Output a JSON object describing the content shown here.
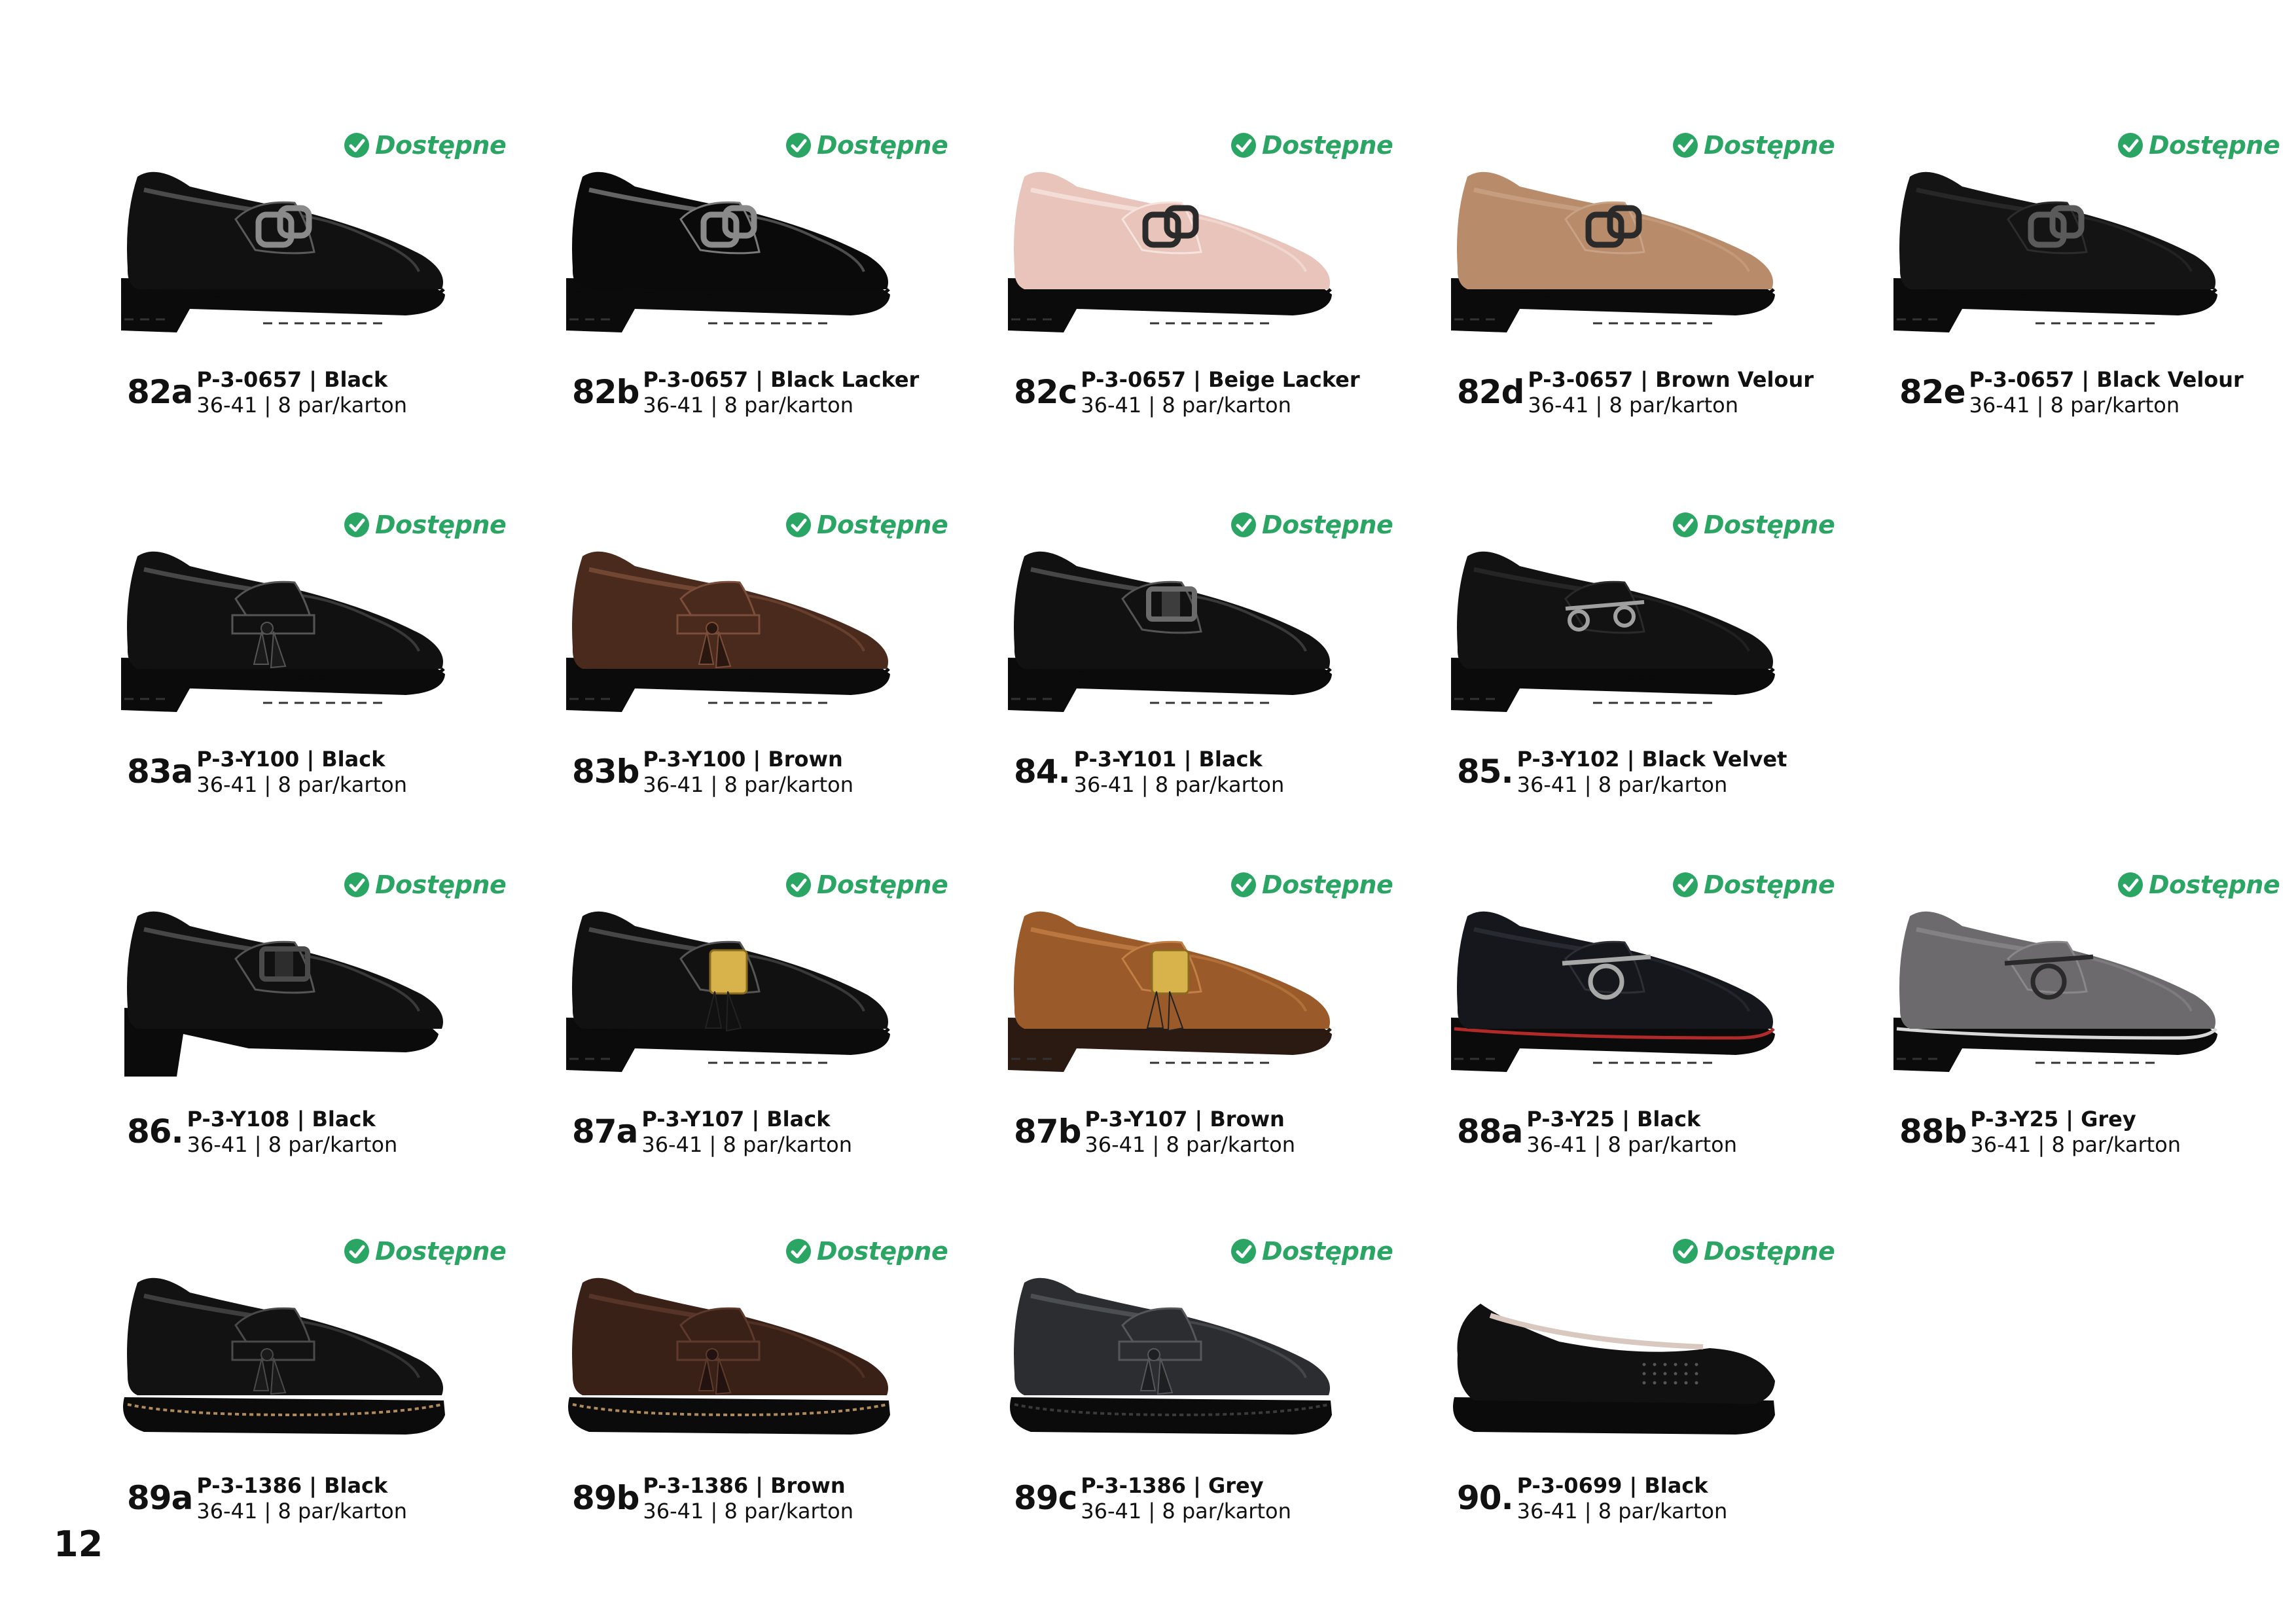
{
  "page_number": "12",
  "badge_text": "Dostępne",
  "badge_color": "#2aa564",
  "products": [
    {
      "num": "82a",
      "code": "P-3-0657 | Black",
      "sizes": "36-41 | 8 par/karton",
      "shoe": {
        "style": "chain",
        "upper": "#111111",
        "shine": "#5a5a5a",
        "sole": "#0b0b0b",
        "welt": "#0b0b0b",
        "heel": "block",
        "acc": "#8a8a8a"
      }
    },
    {
      "num": "82b",
      "code": "P-3-0657 | Black Lacker",
      "sizes": "36-41 | 8 par/karton",
      "shoe": {
        "style": "chain",
        "upper": "#0a0a0a",
        "shine": "#7a7a7a",
        "sole": "#0b0b0b",
        "welt": "#0b0b0b",
        "heel": "block",
        "acc": "#8a8a8a"
      }
    },
    {
      "num": "82c",
      "code": "P-3-0657 | Beige Lacker",
      "sizes": "36-41 | 8 par/karton",
      "shoe": {
        "style": "chain",
        "upper": "#e8c4bb",
        "shine": "#f7e3de",
        "sole": "#0b0b0b",
        "welt": "#0b0b0b",
        "heel": "block",
        "acc": "#2a2a2a"
      }
    },
    {
      "num": "82d",
      "code": "P-3-0657 | Brown Velour",
      "sizes": "36-41 | 8 par/karton",
      "shoe": {
        "style": "chain",
        "upper": "#b88c6a",
        "shine": "#c9a285",
        "sole": "#0b0b0b",
        "welt": "#0b0b0b",
        "heel": "block",
        "acc": "#2a2a2a"
      }
    },
    {
      "num": "82e",
      "code": "P-3-0657 | Black Velour",
      "sizes": "36-41 | 8 par/karton",
      "shoe": {
        "style": "chain",
        "upper": "#141414",
        "shine": "#2c2c2c",
        "sole": "#0b0b0b",
        "welt": "#0b0b0b",
        "heel": "block",
        "acc": "#5a5a5a"
      }
    },
    {
      "num": "83a",
      "code": "P-3-Y100 | Black",
      "sizes": "36-41 | 8 par/karton",
      "shoe": {
        "style": "tassel",
        "upper": "#111111",
        "shine": "#555555",
        "sole": "#0b0b0b",
        "welt": "#0b0b0b",
        "heel": "block",
        "acc": "#1a1a1a"
      }
    },
    {
      "num": "83b",
      "code": "P-3-Y100 | Brown",
      "sizes": "36-41 | 8 par/karton",
      "shoe": {
        "style": "tassel",
        "upper": "#4a2a1c",
        "shine": "#7a4e3a",
        "sole": "#0b0b0b",
        "welt": "#0b0b0b",
        "heel": "block",
        "acc": "#2a1810"
      }
    },
    {
      "num": "84.",
      "code": "P-3-Y101 | Black",
      "sizes": "36-41 | 8 par/karton",
      "shoe": {
        "style": "buckle",
        "upper": "#111111",
        "shine": "#555555",
        "sole": "#0b0b0b",
        "welt": "#0b0b0b",
        "heel": "block",
        "acc": "#6a6a6a"
      }
    },
    {
      "num": "85.",
      "code": "P-3-Y102 | Black Velvet",
      "sizes": "36-41 | 8 par/karton",
      "shoe": {
        "style": "bit",
        "upper": "#121212",
        "shine": "#2a2a2a",
        "sole": "#0b0b0b",
        "welt": "#0b0b0b",
        "heel": "block",
        "acc": "#a0a0a0"
      }
    },
    {
      "num": "86.",
      "code": "P-3-Y108 | Black",
      "sizes": "36-41 | 8 par/karton",
      "shoe": {
        "style": "buckle",
        "upper": "#111111",
        "shine": "#555555",
        "sole": "#0b0b0b",
        "welt": "#0b0b0b",
        "heel": "tall",
        "acc": "#4a4a4a"
      }
    },
    {
      "num": "87a",
      "code": "P-3-Y107 | Black",
      "sizes": "36-41 | 8 par/karton",
      "shoe": {
        "style": "goldtassel",
        "upper": "#111111",
        "shine": "#555555",
        "sole": "#0b0b0b",
        "welt": "#0b0b0b",
        "heel": "block",
        "acc": "#d8b24a"
      }
    },
    {
      "num": "87b",
      "code": "P-3-Y107 | Brown",
      "sizes": "36-41 | 8 par/karton",
      "shoe": {
        "style": "goldtassel",
        "upper": "#9a5a2a",
        "shine": "#c27f46",
        "sole": "#2a1a12",
        "welt": "#2a1a12",
        "heel": "block",
        "acc": "#d8b24a"
      }
    },
    {
      "num": "88a",
      "code": "P-3-Y25 | Black",
      "sizes": "36-41 | 8 par/karton",
      "shoe": {
        "style": "horse",
        "upper": "#15171c",
        "shine": "#2c2f36",
        "sole": "#0b0b0b",
        "welt": "#b02a2a",
        "heel": "block",
        "acc": "#a8a8a8"
      }
    },
    {
      "num": "88b",
      "code": "P-3-Y25 | Grey",
      "sizes": "36-41 | 8 par/karton",
      "shoe": {
        "style": "horse",
        "upper": "#6d6a6e",
        "shine": "#8a878b",
        "sole": "#0b0b0b",
        "welt": "#d8d8d8",
        "heel": "block",
        "acc": "#2a2a2a"
      }
    },
    {
      "num": "89a",
      "code": "P-3-1386 | Black",
      "sizes": "36-41 | 8 par/karton",
      "shoe": {
        "style": "tassel",
        "upper": "#121212",
        "shine": "#4a4a4a",
        "sole": "#0b0b0b",
        "welt": "#b08a5a",
        "heel": "wedge",
        "acc": "#1a1a1a"
      }
    },
    {
      "num": "89b",
      "code": "P-3-1386 | Brown",
      "sizes": "36-41 | 8 par/karton",
      "shoe": {
        "style": "tassel",
        "upper": "#3a2118",
        "shine": "#5e3a2c",
        "sole": "#0b0b0b",
        "welt": "#b08a5a",
        "heel": "wedge",
        "acc": "#221310"
      }
    },
    {
      "num": "89c",
      "code": "P-3-1386 | Grey",
      "sizes": "36-41 | 8 par/karton",
      "shoe": {
        "style": "tassel",
        "upper": "#2b2d30",
        "shine": "#55575b",
        "sole": "#0b0b0b",
        "welt": "#3a3a3a",
        "heel": "wedge",
        "acc": "#1e1f21"
      }
    },
    {
      "num": "90.",
      "code": "P-3-0699 | Black",
      "sizes": "36-41 | 8 par/karton",
      "shoe": {
        "style": "ballet",
        "upper": "#111111",
        "shine": "#444444",
        "sole": "#0b0b0b",
        "welt": "#0b0b0b",
        "heel": "wedge",
        "acc": "#2a2a2a"
      }
    }
  ]
}
